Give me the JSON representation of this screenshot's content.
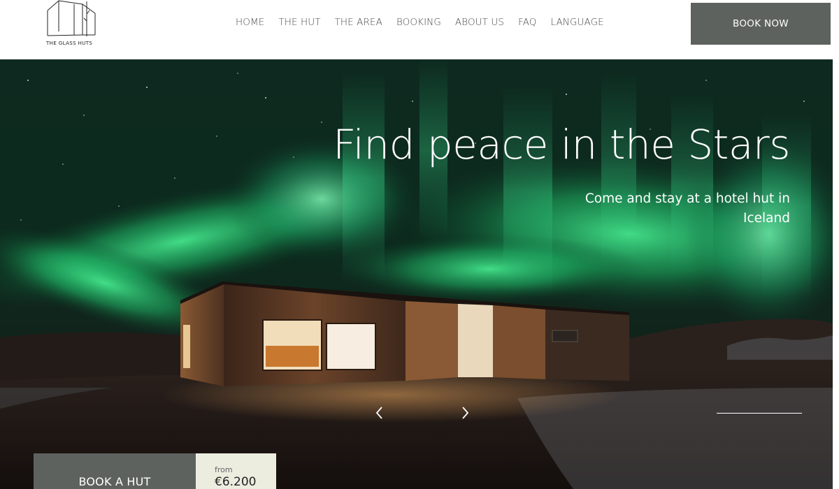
{
  "header": {
    "logo_text": "THE GLASS HUTS",
    "nav": [
      "HOME",
      "THE HUT",
      "THE AREA",
      "BOOKING",
      "ABOUT US",
      "FAQ",
      "LANGUAGE"
    ],
    "book_now_label": "BOOK NOW"
  },
  "hero": {
    "title": "Find peace in the Stars",
    "subtitle": "Come and stay at a hotel hut in Iceland",
    "prev_icon": "chevron-left-icon",
    "next_icon": "chevron-right-icon"
  },
  "booking": {
    "button_label": "BOOK A HUT",
    "price_prefix": "from",
    "price_value": "€6.200"
  },
  "colors": {
    "button_bg": "#5d625f",
    "price_bg": "#ececdf",
    "aurora": "#2fd17a"
  }
}
